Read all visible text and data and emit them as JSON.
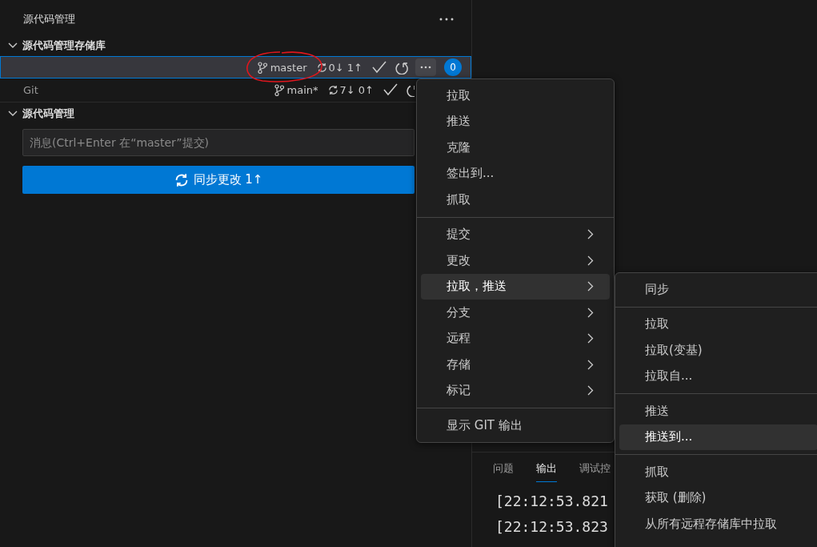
{
  "sidebar": {
    "title": "源代码管理",
    "repositories": {
      "title": "源代码管理存储库",
      "expanded": true,
      "items": [
        {
          "selected": true,
          "branch": "master",
          "sync": "0↓ 1↑",
          "badge": "0",
          "annotated": true
        },
        {
          "name": "Git",
          "selected": false,
          "branch": "main*",
          "sync": "7↓ 0↑",
          "annotated": false
        }
      ]
    },
    "changes": {
      "title": "源代码管理",
      "expanded": true,
      "placeholder": "消息(Ctrl+Enter 在“master”提交)",
      "button": "同步更改 1↑"
    }
  },
  "context_menu": {
    "groups": [
      [
        {
          "label": "拉取",
          "submenu": false,
          "selected": false
        },
        {
          "label": "推送",
          "submenu": false,
          "selected": false
        },
        {
          "label": "克隆",
          "submenu": false,
          "selected": false
        },
        {
          "label": "签出到...",
          "submenu": false,
          "selected": false
        },
        {
          "label": "抓取",
          "submenu": false,
          "selected": false
        }
      ],
      [
        {
          "label": "提交",
          "submenu": true,
          "selected": false
        },
        {
          "label": "更改",
          "submenu": true,
          "selected": false
        },
        {
          "label": "拉取，推送",
          "submenu": true,
          "selected": true
        },
        {
          "label": "分支",
          "submenu": true,
          "selected": false
        },
        {
          "label": "远程",
          "submenu": true,
          "selected": false
        },
        {
          "label": "存储",
          "submenu": true,
          "selected": false
        },
        {
          "label": "标记",
          "submenu": true,
          "selected": false
        }
      ],
      [
        {
          "label": "显示 GIT 输出",
          "submenu": false,
          "selected": false
        }
      ]
    ]
  },
  "submenu": {
    "groups": [
      [
        {
          "label": "同步",
          "selected": false
        }
      ],
      [
        {
          "label": "拉取",
          "selected": false
        },
        {
          "label": "拉取(变基)",
          "selected": false
        },
        {
          "label": "拉取自...",
          "selected": false
        }
      ],
      [
        {
          "label": "推送",
          "selected": false
        },
        {
          "label": "推送到...",
          "selected": true
        }
      ],
      [
        {
          "label": "抓取",
          "selected": false
        },
        {
          "label": "获取 (删除)",
          "selected": false
        },
        {
          "label": "从所有远程存储库中拉取",
          "selected": false
        }
      ]
    ]
  },
  "panel": {
    "tabs": [
      {
        "label": "问题",
        "selected": false
      },
      {
        "label": "输出",
        "selected": true
      },
      {
        "label": "调试控",
        "selected": false
      }
    ],
    "lines": [
      "[22:12:53.821",
      "[22:12:53.823"
    ]
  }
}
